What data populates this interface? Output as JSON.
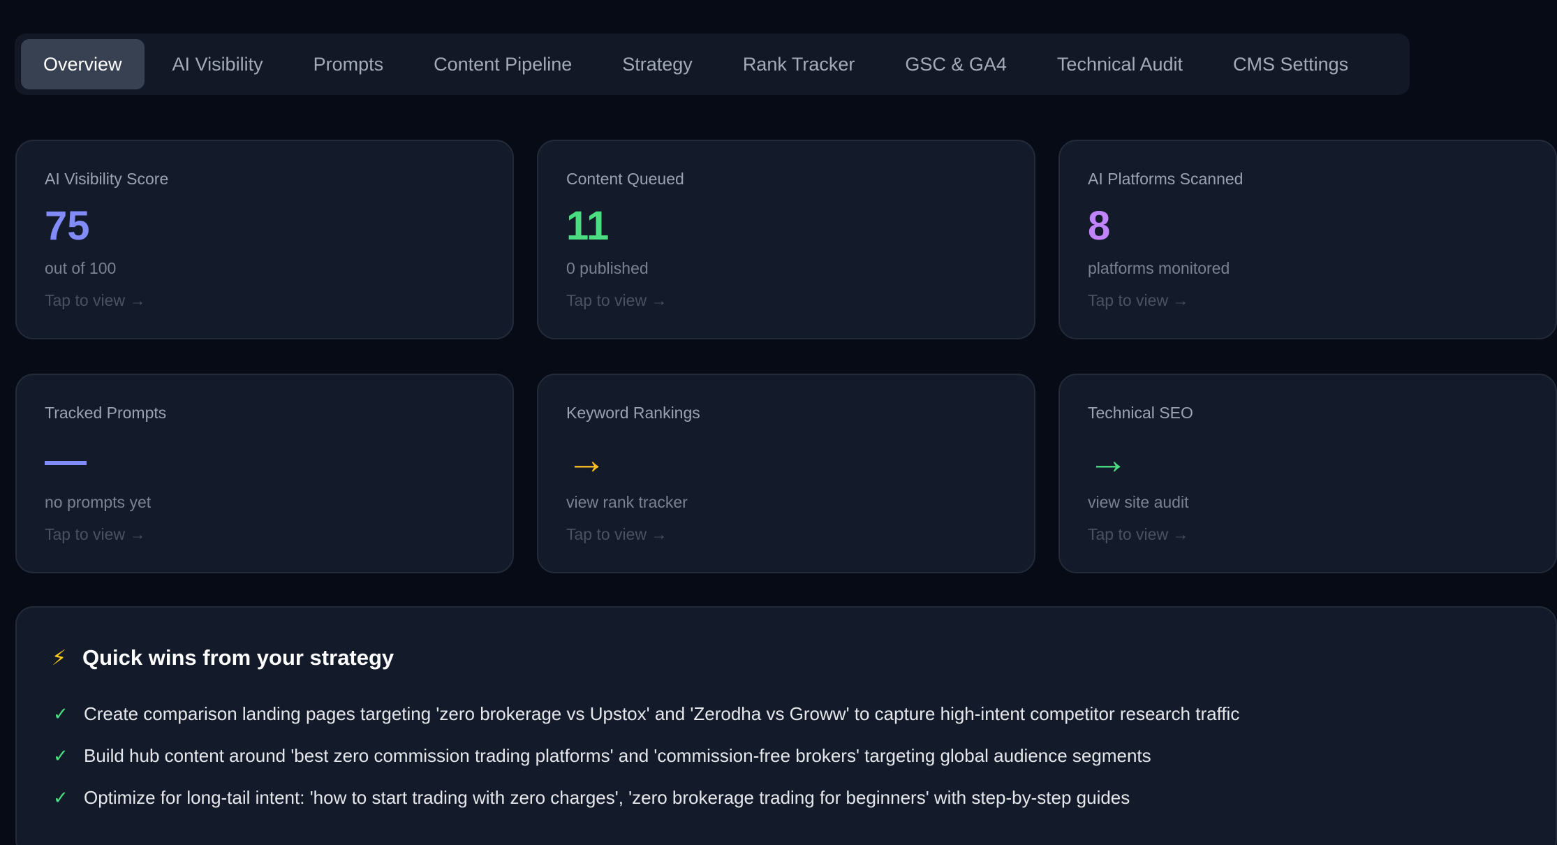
{
  "tabs": [
    {
      "label": "Overview",
      "active": true
    },
    {
      "label": "AI Visibility",
      "active": false
    },
    {
      "label": "Prompts",
      "active": false
    },
    {
      "label": "Content Pipeline",
      "active": false
    },
    {
      "label": "Strategy",
      "active": false
    },
    {
      "label": "Rank Tracker",
      "active": false
    },
    {
      "label": "GSC & GA4",
      "active": false
    },
    {
      "label": "Technical Audit",
      "active": false
    },
    {
      "label": "CMS Settings",
      "active": false
    }
  ],
  "cards": [
    {
      "title": "AI Visibility Score",
      "value": "75",
      "sub": "out of 100",
      "link": "Tap to view →",
      "color": "#818cf8"
    },
    {
      "title": "Content Queued",
      "value": "11",
      "sub": "0 published",
      "link": "Tap to view →",
      "color": "#4ade80"
    },
    {
      "title": "AI Platforms Scanned",
      "value": "8",
      "sub": "platforms monitored",
      "link": "Tap to view →",
      "color": "#c084fc"
    },
    {
      "title": "Tracked Prompts",
      "value": "—",
      "sub": "no prompts yet",
      "link": "Tap to view →",
      "color": "#818cf8"
    },
    {
      "title": "Keyword Rankings",
      "value": "→",
      "sub": "view rank tracker",
      "link": "Tap to view →",
      "color": "#fbbf24"
    },
    {
      "title": "Technical SEO",
      "value": "→",
      "sub": "view site audit",
      "link": "Tap to view →",
      "color": "#4ade80"
    }
  ],
  "quick_wins": {
    "icon": "lightning-bolt-icon",
    "icon_glyph": "⚡",
    "title": "Quick wins from your strategy",
    "check_glyph": "✓",
    "items": [
      "Create comparison landing pages targeting 'zero brokerage vs Upstox' and 'Zerodha vs Groww' to capture high-intent competitor research traffic",
      "Build hub content around 'best zero commission trading platforms' and 'commission-free brokers' targeting global audience segments",
      "Optimize for long-tail intent: 'how to start trading with zero charges', 'zero brokerage trading for beginners' with step-by-step guides"
    ]
  },
  "colors": {
    "background": "#070b16",
    "card": "#131a2a",
    "tab_active": "#374151",
    "accent_blue": "#818cf8",
    "accent_green": "#4ade80",
    "accent_purple": "#c084fc",
    "accent_amber": "#fbbf24"
  }
}
